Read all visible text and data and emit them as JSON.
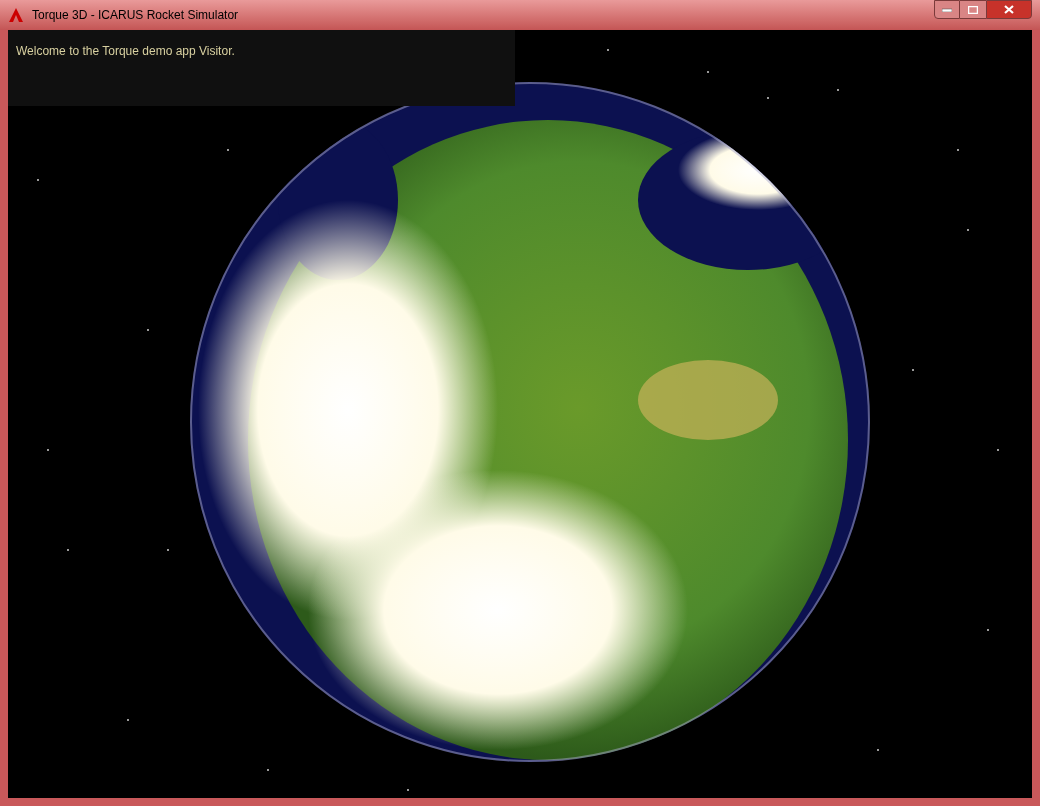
{
  "window": {
    "title": "Torque 3D - ICARUS Rocket Simulator"
  },
  "console": {
    "message": "Welcome to the Torque demo app Visitor."
  }
}
